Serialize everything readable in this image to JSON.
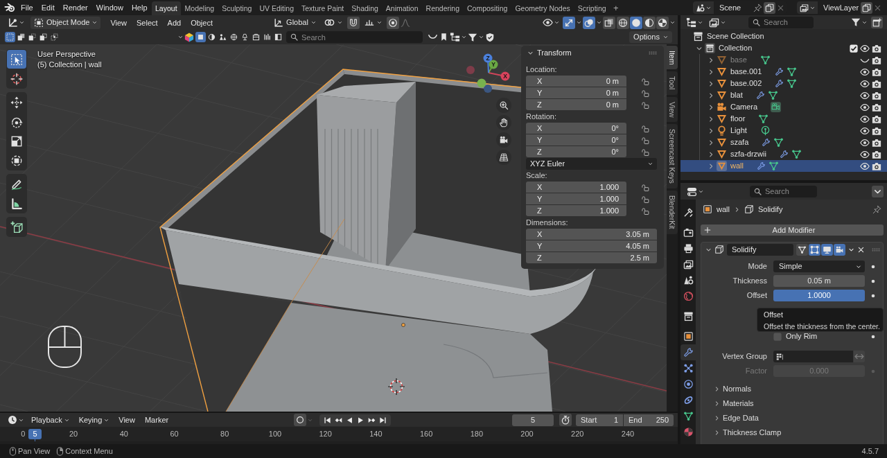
{
  "top_bar": {
    "menus": [
      "File",
      "Edit",
      "Render",
      "Window",
      "Help"
    ],
    "workspaces": [
      {
        "label": "Layout",
        "selected": true
      },
      {
        "label": "Modeling",
        "selected": false
      },
      {
        "label": "Sculpting",
        "selected": false
      },
      {
        "label": "UV Editing",
        "selected": false
      },
      {
        "label": "Texture Paint",
        "selected": false
      },
      {
        "label": "Shading",
        "selected": false
      },
      {
        "label": "Animation",
        "selected": false
      },
      {
        "label": "Rendering",
        "selected": false
      },
      {
        "label": "Compositing",
        "selected": false
      },
      {
        "label": "Geometry Nodes",
        "selected": false
      },
      {
        "label": "Scripting",
        "selected": false
      }
    ],
    "add_workspace": "+",
    "scene": "Scene",
    "view_layer": "ViewLayer"
  },
  "viewport": {
    "header": {
      "mode": "Object Mode",
      "menus": [
        "View",
        "Select",
        "Add",
        "Object"
      ],
      "orientation": "Global",
      "toggles": [
        {
          "on": true
        },
        {
          "on": true
        },
        {
          "on": false
        }
      ],
      "shading": [
        {
          "selected": false
        },
        {
          "selected": true
        },
        {
          "selected": false
        },
        {
          "selected": false
        }
      ]
    },
    "tool_header": {
      "select_modes": [
        {
          "selected": true
        },
        {
          "selected": false
        },
        {
          "selected": false
        },
        {
          "selected": false
        },
        {
          "selected": false
        }
      ],
      "type_filters": [
        {
          "selected": true
        },
        {
          "selected": false
        },
        {
          "selected": false
        },
        {
          "selected": false
        },
        {
          "selected": false
        },
        {
          "selected": false
        },
        {
          "selected": false
        },
        {
          "selected": false
        }
      ],
      "search": {
        "placeholder": "Search"
      },
      "options": "Options"
    },
    "info": [
      "User Perspective",
      "(5) Collection | wall"
    ],
    "tools": [
      {
        "selected": true
      },
      {
        "selected": false
      },
      {
        "selected": false
      },
      {
        "selected": false
      },
      {
        "selected": false
      },
      {
        "selected": false
      },
      {
        "selected": false
      },
      {
        "selected": false
      },
      {
        "selected": false
      }
    ],
    "gizmo": {
      "axes": [
        "X",
        "Y",
        "Z"
      ]
    },
    "transform": {
      "title": "Transform",
      "expanded": true,
      "items": [
        {
          "kind": "vector",
          "label": "Location:",
          "lockable": true,
          "rows": [
            {
              "axis": "X",
              "value": "0 m"
            },
            {
              "axis": "Y",
              "value": "0 m"
            },
            {
              "axis": "Z",
              "value": "0 m"
            }
          ]
        },
        {
          "kind": "vector",
          "label": "Rotation:",
          "lockable": true,
          "rows": [
            {
              "axis": "X",
              "value": "0°"
            },
            {
              "axis": "Y",
              "value": "0°"
            },
            {
              "axis": "Z",
              "value": "0°"
            }
          ]
        },
        {
          "kind": "dropdown",
          "value": "XYZ Euler"
        },
        {
          "kind": "vector",
          "label": "Scale:",
          "lockable": true,
          "rows": [
            {
              "axis": "X",
              "value": "1.000"
            },
            {
              "axis": "Y",
              "value": "1.000"
            },
            {
              "axis": "Z",
              "value": "1.000"
            }
          ]
        },
        {
          "kind": "vector",
          "label": "Dimensions:",
          "lockable": false,
          "rows": [
            {
              "axis": "X",
              "value": "3.05 m"
            },
            {
              "axis": "Y",
              "value": "4.05 m"
            },
            {
              "axis": "Z",
              "value": "2.5 m"
            }
          ]
        }
      ]
    },
    "sidebar_tabs": [
      {
        "label": "Item",
        "selected": true
      },
      {
        "label": "Tool",
        "selected": false
      },
      {
        "label": "View",
        "selected": false
      },
      {
        "label": "Screencast Keys",
        "selected": false
      },
      {
        "label": "BlenderKit",
        "selected": false
      }
    ]
  },
  "timeline": {
    "menus": [
      {
        "label": "Playback",
        "kind": "dropdown"
      },
      {
        "label": "Keying",
        "kind": "dropdown"
      },
      {
        "label": "View",
        "kind": "menu"
      },
      {
        "label": "Marker",
        "kind": "menu"
      }
    ],
    "current_frame": "5",
    "start": {
      "label": "Start",
      "value": "1"
    },
    "end": {
      "label": "End",
      "value": "250"
    },
    "ruler": [
      "0",
      "20",
      "40",
      "60",
      "80",
      "100",
      "120",
      "140",
      "160",
      "180",
      "200",
      "220",
      "240"
    ],
    "playhead": "5"
  },
  "outliner": {
    "search": {
      "placeholder": "Search"
    },
    "tree": [
      {
        "label": "Scene Collection",
        "kind": "scene_collection",
        "children": [
          {
            "label": "Collection",
            "kind": "collection",
            "expanded": true,
            "checked": true,
            "visible": true,
            "children": [
              {
                "label": "base",
                "kind": "mesh",
                "expanded": false,
                "modifiers": false,
                "data_active": false,
                "visible": false,
                "selected": false
              },
              {
                "label": "base.001",
                "kind": "mesh",
                "expanded": false,
                "modifiers": true,
                "data_active": false,
                "visible": true,
                "selected": false
              },
              {
                "label": "base.002",
                "kind": "mesh",
                "expanded": false,
                "modifiers": true,
                "data_active": false,
                "visible": true,
                "selected": false
              },
              {
                "label": "blat",
                "kind": "mesh",
                "expanded": false,
                "modifiers": true,
                "data_active": false,
                "visible": true,
                "selected": false
              },
              {
                "label": "Camera",
                "kind": "camera",
                "expanded": false,
                "modifiers": false,
                "data_active": true,
                "visible": true,
                "selected": false
              },
              {
                "label": "floor",
                "kind": "mesh",
                "expanded": false,
                "modifiers": false,
                "data_active": false,
                "visible": true,
                "selected": false
              },
              {
                "label": "Light",
                "kind": "light",
                "expanded": false,
                "modifiers": false,
                "data_active": false,
                "visible": true,
                "selected": false
              },
              {
                "label": "szafa",
                "kind": "mesh",
                "expanded": false,
                "modifiers": true,
                "data_active": false,
                "visible": true,
                "selected": false
              },
              {
                "label": "szfa-drzwii",
                "kind": "mesh",
                "expanded": false,
                "modifiers": true,
                "data_active": false,
                "visible": true,
                "selected": false
              },
              {
                "label": "wall",
                "kind": "mesh",
                "expanded": false,
                "modifiers": true,
                "data_active": false,
                "visible": true,
                "selected": true
              }
            ]
          }
        ]
      }
    ]
  },
  "properties": {
    "search": {
      "placeholder": "Search"
    },
    "tabs": [
      {
        "selected": false
      },
      {
        "selected": false
      },
      {
        "selected": false
      },
      {
        "selected": false
      },
      {
        "selected": false
      },
      {
        "selected": false
      },
      {
        "selected": false
      },
      {
        "selected": false
      },
      {
        "selected": true
      },
      {
        "selected": false
      },
      {
        "selected": false
      },
      {
        "selected": false
      },
      {
        "selected": false
      },
      {
        "selected": false
      }
    ],
    "breadcrumb": [
      "wall",
      "Solidify"
    ],
    "add_modifier": "Add Modifier",
    "modifier": {
      "name": "Solidify",
      "expanded": true,
      "toggles": [
        {
          "on": false
        },
        {
          "on": true
        },
        {
          "on": true
        },
        {
          "on": true
        }
      ],
      "fields": [
        {
          "kind": "dropdown",
          "label": "Mode",
          "value": "Simple"
        },
        {
          "kind": "number",
          "label": "Thickness",
          "value": "0.05 m",
          "active": false
        },
        {
          "kind": "number",
          "label": "Offset",
          "value": "1.0000",
          "active": true
        }
      ],
      "options": [
        {
          "label": "Only Rim",
          "checked": false
        }
      ],
      "vertex_group": {
        "label": "Vertex Group"
      },
      "factor": {
        "label": "Factor",
        "value": "0.000",
        "disabled": true
      },
      "subpanels": [
        {
          "label": "Normals",
          "expanded": false
        },
        {
          "label": "Materials",
          "expanded": false
        },
        {
          "label": "Edge Data",
          "expanded": false
        },
        {
          "label": "Thickness Clamp",
          "expanded": false
        }
      ]
    }
  },
  "tooltip": {
    "title": "Offset",
    "text": "Offset the thickness from the center."
  },
  "status_bar": {
    "hints": [
      "Pan View",
      "Context Menu"
    ],
    "version": "4.5.7"
  }
}
